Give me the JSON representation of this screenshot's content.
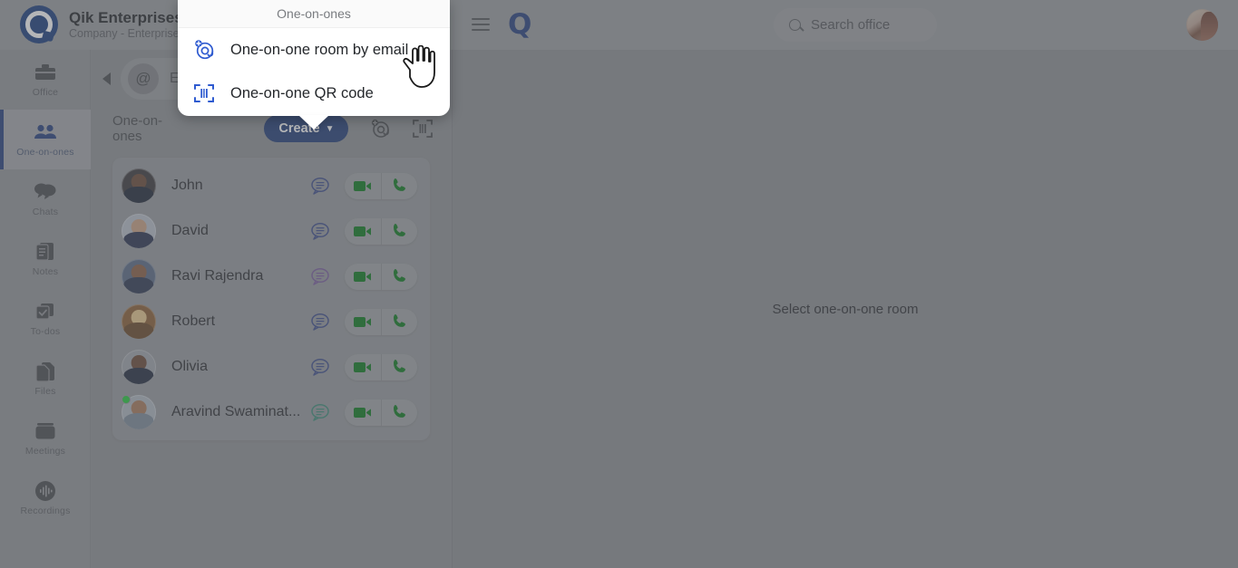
{
  "brand": {
    "title": "Qik Enterprises",
    "subtitle": "Company - Enterprise",
    "logo_icon": "qik-logo-icon"
  },
  "topbar": {
    "menu_icon": "hamburger-menu-icon",
    "app_logo": "q-logo-icon",
    "search": {
      "placeholder": "Search office",
      "icon": "search-icon"
    },
    "avatar_icon": "user-avatar"
  },
  "sidebar": {
    "items": [
      {
        "label": "Office",
        "icon": "briefcase-icon",
        "active": false
      },
      {
        "label": "One-on-ones",
        "icon": "people-icon",
        "active": true
      },
      {
        "label": "Chats",
        "icon": "chat-bubbles-icon",
        "active": false
      },
      {
        "label": "Notes",
        "icon": "notes-icon",
        "active": false
      },
      {
        "label": "To-dos",
        "icon": "checkbox-icon",
        "active": false
      },
      {
        "label": "Files",
        "icon": "files-icon",
        "active": false
      },
      {
        "label": "Meetings",
        "icon": "meetings-icon",
        "active": false
      },
      {
        "label": "Recordings",
        "icon": "recordings-icon",
        "active": false
      }
    ]
  },
  "list_panel": {
    "collapse_icon": "collapse-left-arrow-icon",
    "email_search": {
      "at_icon": "at-sign-icon",
      "placeholder": "Email"
    },
    "section_title": "One-on-ones",
    "create_button": {
      "label": "Create",
      "caret": "▼"
    },
    "add_by_email_icon": "at-plus-icon",
    "qr_code_icon": "qr-code-icon",
    "contacts": [
      {
        "name": "John",
        "online": false,
        "chat_color": "#3f4f8c",
        "avatar_head": "#6b4a38",
        "avatar_body": "#20283a",
        "avatar_bg": "#3b3a3d"
      },
      {
        "name": "David",
        "online": false,
        "chat_color": "#3f4f8c",
        "avatar_head": "#c9a083",
        "avatar_body": "#2b3350",
        "avatar_bg": "#b7bec9"
      },
      {
        "name": "Ravi Rajendra",
        "online": false,
        "chat_color": "#7a5f9e",
        "avatar_head": "#8a5f44",
        "avatar_body": "#2e3a52",
        "avatar_bg": "#5a6b85"
      },
      {
        "name": "Robert",
        "online": false,
        "chat_color": "#3f4f8c",
        "avatar_head": "#e8c98f",
        "avatar_body": "#6b4a2a",
        "avatar_bg": "#8a5f35"
      },
      {
        "name": "Olivia",
        "online": false,
        "chat_color": "#3f4f8c",
        "avatar_head": "#6b4a38",
        "avatar_body": "#232c40",
        "avatar_bg": "#9fa4ab"
      },
      {
        "name": "Aravind Swaminat...",
        "online": true,
        "chat_color": "#3f8c7a",
        "avatar_head": "#a87a5c",
        "avatar_body": "#7c8a9a",
        "avatar_bg": "#aeb6c0"
      }
    ],
    "row_actions": {
      "chat_icon": "chat-bubble-icon",
      "video_icon": "video-camera-icon",
      "phone_icon": "phone-icon"
    }
  },
  "main": {
    "empty_state_text": "Select one-on-one room"
  },
  "popup": {
    "title": "One-on-ones",
    "items": [
      {
        "label": "One-on-one room by email",
        "icon": "at-plus-icon"
      },
      {
        "label": "One-on-one QR code",
        "icon": "qr-code-icon"
      }
    ]
  },
  "cursor": {
    "icon": "pointing-hand-cursor"
  },
  "colors": {
    "brand_blue": "#27407e",
    "create_button": "#243f78",
    "call_green": "#0d7a1f",
    "online_green": "#27c93f",
    "page_bg": "#8d9094"
  }
}
